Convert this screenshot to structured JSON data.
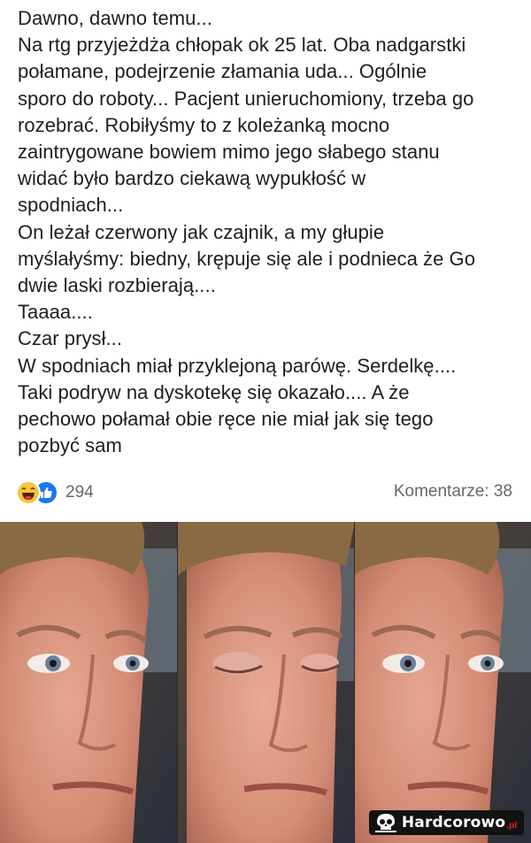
{
  "post": {
    "lines": [
      "Dawno, dawno temu...",
      "Na rtg przyjeżdża chłopak ok 25 lat. Oba nadgarstki",
      "połamane, podejrzenie złamania uda... Ogólnie",
      "sporo do roboty... Pacjent unieruchomiony, trzeba go",
      "rozebrać. Robiłyśmy to z koleżanką mocno",
      "zaintrygowane bowiem mimo jego słabego stanu",
      "widać było bardzo ciekawą wypukłość w",
      "spodniach...",
      "On leżał czerwony jak czajnik, a my głupie",
      "myślałyśmy: biedny, krępuje się ale i podnieca że Go",
      "dwie laski rozbierają....",
      "Taaaa....",
      "Czar prysł...",
      "W spodniach miał przyklejoną parówę. Serdelkę....",
      "Taki podryw na dyskotekę się okazało.... A że",
      "pechowo połamał obie ręce nie miał jak się tego",
      "pozbyć sam"
    ]
  },
  "reactions": {
    "icons": [
      "haha-icon",
      "like-icon"
    ],
    "count": "294"
  },
  "comments": {
    "label": "Komentarze: 38"
  },
  "meme": {
    "panels": [
      "eyes-open",
      "eyes-closed",
      "eyes-open"
    ]
  },
  "watermark": {
    "text": "Hardcorowo",
    "suffix": ".pl"
  },
  "colors": {
    "text": "#1c1e21",
    "muted": "#65676b",
    "like_blue": "#1877f2",
    "haha_yellow": "#f7c53a"
  }
}
